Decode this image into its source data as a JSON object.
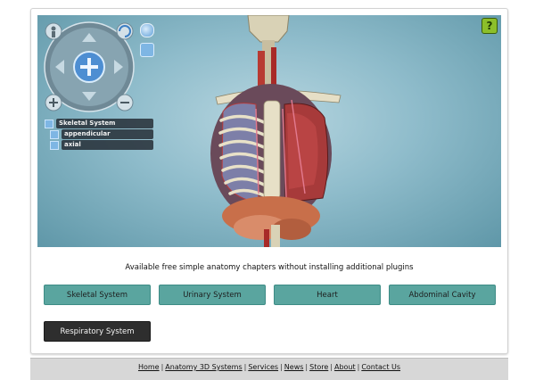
{
  "viewer": {
    "help_label": "?",
    "nav_icons": [
      "person-icon",
      "rotate-icon",
      "zoom-in-icon",
      "zoom-out-icon",
      "center-icon"
    ],
    "layers": [
      {
        "label": "Skeletal System"
      },
      {
        "label": "appendicular"
      },
      {
        "label": "axial"
      }
    ]
  },
  "tagline": "Available free simple anatomy chapters without installing additional plugins",
  "chapters": [
    {
      "label": "Skeletal System"
    },
    {
      "label": "Urinary System"
    },
    {
      "label": "Heart"
    },
    {
      "label": "Abdominal Cavity"
    },
    {
      "label": "Respiratory System"
    }
  ],
  "footer": {
    "links": [
      "Home",
      "Anatomy 3D Systems",
      "Services",
      "News",
      "Store",
      "About",
      "Contact Us"
    ]
  },
  "colors": {
    "chapter_button": "#5aa59f",
    "chapter_button_active": "#2e2e2e",
    "viewer_bg": "#8fbccb"
  }
}
